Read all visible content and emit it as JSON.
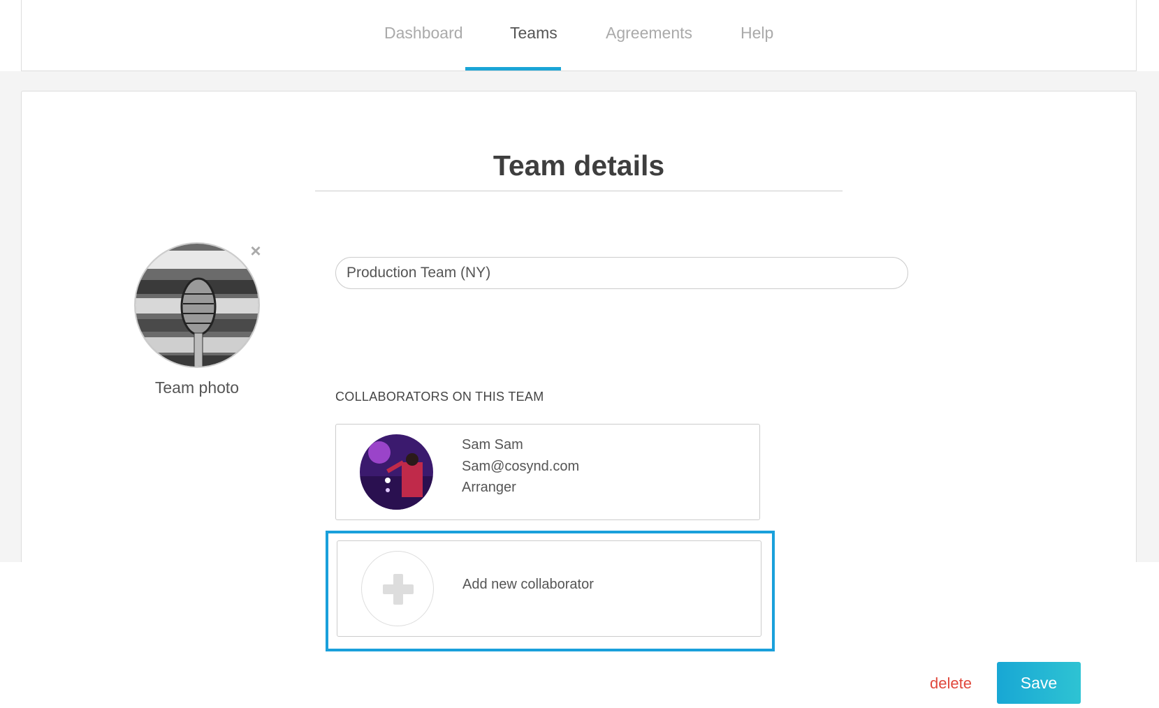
{
  "nav": {
    "tabs": [
      {
        "label": "Dashboard",
        "active": false
      },
      {
        "label": "Teams",
        "active": true
      },
      {
        "label": "Agreements",
        "active": false
      },
      {
        "label": "Help",
        "active": false
      }
    ]
  },
  "page": {
    "title": "Team details"
  },
  "team": {
    "photo_label": "Team photo",
    "name_value": "Production Team (NY)"
  },
  "collaborators": {
    "heading": "COLLABORATORS ON THIS TEAM",
    "items": [
      {
        "name": "Sam Sam",
        "email": "Sam@cosynd.com",
        "role": "Arranger"
      }
    ],
    "add_label": "Add new collaborator"
  },
  "actions": {
    "delete_label": "delete",
    "save_label": "Save"
  },
  "colors": {
    "accent": "#1aa5d6",
    "delete": "#e0483c",
    "highlight_border": "#1aa0db"
  }
}
